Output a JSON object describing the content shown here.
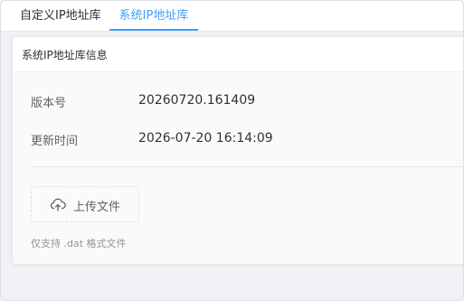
{
  "tabs": [
    {
      "label": "自定义IP地址库"
    },
    {
      "label": "系统IP地址库",
      "active": true
    }
  ],
  "card": {
    "title": "系统IP地址库信息",
    "rows": [
      {
        "label": "版本号",
        "value": "20260720.161409"
      },
      {
        "label": "更新时间",
        "value": "2026-07-20 16:14:09"
      }
    ],
    "upload_label": "上传文件",
    "upload_icon": "cloud-upload-icon",
    "hint": "仅支持 .dat 格式文件"
  },
  "colors": {
    "accent": "#409eff",
    "text": "#303133",
    "muted": "#909399"
  }
}
